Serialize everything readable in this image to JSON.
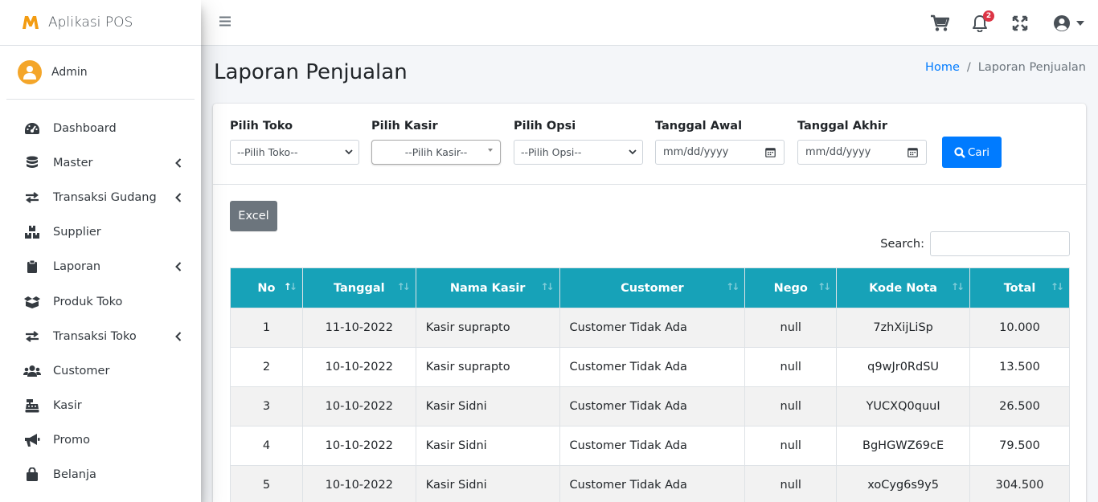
{
  "brand": {
    "title": "Aplikasi POS",
    "accent": "#f39c12"
  },
  "user": {
    "name": "Admin"
  },
  "sidebar": {
    "items": [
      {
        "label": "Dashboard",
        "icon": "tachometer-icon",
        "has_children": false
      },
      {
        "label": "Master",
        "icon": "database-icon",
        "has_children": true
      },
      {
        "label": "Transaksi Gudang",
        "icon": "exchange-icon",
        "has_children": true
      },
      {
        "label": "Supplier",
        "icon": "boxes-icon",
        "has_children": false
      },
      {
        "label": "Laporan",
        "icon": "clipboard-icon",
        "has_children": true
      },
      {
        "label": "Produk Toko",
        "icon": "box-open-icon",
        "has_children": false
      },
      {
        "label": "Transaksi Toko",
        "icon": "exchange-icon",
        "has_children": true
      },
      {
        "label": "Customer",
        "icon": "users-icon",
        "has_children": false
      },
      {
        "label": "Kasir",
        "icon": "cash-register-icon",
        "has_children": false
      },
      {
        "label": "Promo",
        "icon": "bullhorn-icon",
        "has_children": false
      },
      {
        "label": "Belanja",
        "icon": "shopping-bag-icon",
        "has_children": false
      }
    ]
  },
  "topbar": {
    "notification_count": "2"
  },
  "page": {
    "title": "Laporan Penjualan"
  },
  "breadcrumb": {
    "home": "Home",
    "separator": "/",
    "current": "Laporan Penjualan"
  },
  "filters": {
    "toko": {
      "label": "Pilih Toko",
      "value": "--Pilih Toko--"
    },
    "kasir": {
      "label": "Pilih Kasir",
      "value": "--Pilih Kasir--"
    },
    "opsi": {
      "label": "Pilih Opsi",
      "value": "--Pilih Opsi--"
    },
    "tanggal_awal": {
      "label": "Tanggal Awal",
      "placeholder": "mm/dd/yyyy"
    },
    "tanggal_akhir": {
      "label": "Tanggal Akhir",
      "placeholder": "mm/dd/yyyy"
    },
    "cari_label": "Cari"
  },
  "excel_label": "Excel",
  "search": {
    "label": "Search:",
    "value": ""
  },
  "table": {
    "columns": [
      "No",
      "Tanggal",
      "Nama Kasir",
      "Customer",
      "Nego",
      "Kode Nota",
      "Total"
    ],
    "sorted_column": "No",
    "header_color": "#17a2b8",
    "rows": [
      {
        "no": "1",
        "tanggal": "11-10-2022",
        "kasir": "Kasir suprapto",
        "customer": "Customer Tidak Ada",
        "nego": "null",
        "kode": "7zhXijLiSp",
        "total": "10.000"
      },
      {
        "no": "2",
        "tanggal": "10-10-2022",
        "kasir": "Kasir suprapto",
        "customer": "Customer Tidak Ada",
        "nego": "null",
        "kode": "q9wJr0RdSU",
        "total": "13.500"
      },
      {
        "no": "3",
        "tanggal": "10-10-2022",
        "kasir": "Kasir Sidni",
        "customer": "Customer Tidak Ada",
        "nego": "null",
        "kode": "YUCXQ0quuI",
        "total": "26.500"
      },
      {
        "no": "4",
        "tanggal": "10-10-2022",
        "kasir": "Kasir Sidni",
        "customer": "Customer Tidak Ada",
        "nego": "null",
        "kode": "BgHGWZ69cE",
        "total": "79.500"
      },
      {
        "no": "5",
        "tanggal": "10-10-2022",
        "kasir": "Kasir Sidni",
        "customer": "Customer Tidak Ada",
        "nego": "null",
        "kode": "xoCyg6s9y5",
        "total": "304.500"
      }
    ]
  }
}
